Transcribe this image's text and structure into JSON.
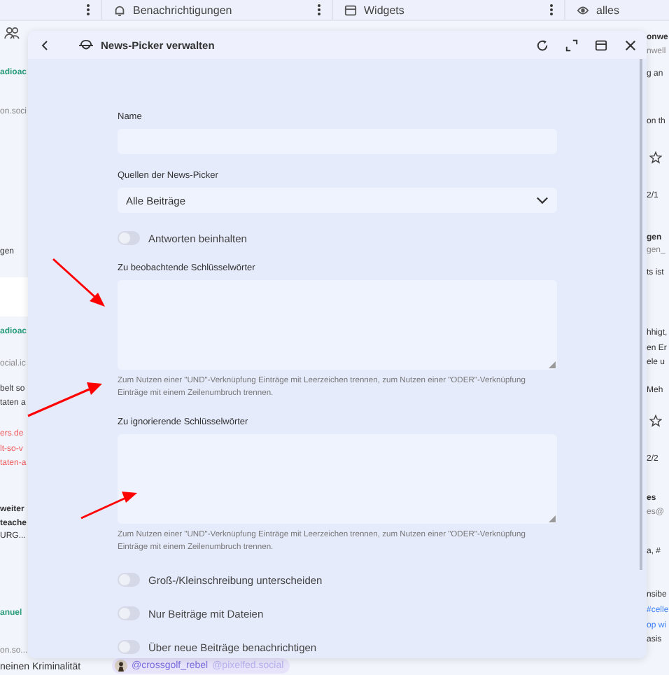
{
  "background": {
    "column_headers": [
      {
        "label": "Benachrichtigungen"
      },
      {
        "label": "Widgets"
      },
      {
        "label": "alles"
      }
    ],
    "left_fragments": [
      {
        "kind": "name",
        "text": "adioac"
      },
      {
        "kind": "handle",
        "text": "on.soci"
      },
      {
        "kind": "text",
        "text": "gen"
      },
      {
        "kind": "name",
        "text": "adioac"
      },
      {
        "kind": "handle",
        "text": "ocial.ic"
      },
      {
        "kind": "text",
        "text": "belt so"
      },
      {
        "kind": "text",
        "text": "taten a"
      },
      {
        "kind": "link",
        "text": "ers.de"
      },
      {
        "kind": "link",
        "text": "lt-so-v"
      },
      {
        "kind": "link",
        "text": "taten-a"
      },
      {
        "kind": "bold",
        "text": "weiter"
      },
      {
        "kind": "bold",
        "text": "teache"
      },
      {
        "kind": "text",
        "text": "URG..."
      },
      {
        "kind": "name",
        "text": "anuel"
      },
      {
        "kind": "handle",
        "text": "on.so..."
      }
    ],
    "right_fragments": [
      {
        "kind": "bold",
        "text": "onwe"
      },
      {
        "kind": "handle",
        "text": "nwell"
      },
      {
        "kind": "text",
        "text": "g an"
      },
      {
        "kind": "text",
        "text": "on th"
      },
      {
        "kind": "star"
      },
      {
        "kind": "text",
        "text": "2/1"
      },
      {
        "kind": "bold",
        "text": "gen"
      },
      {
        "kind": "handle",
        "text": "gen_"
      },
      {
        "kind": "text",
        "text": "ts ist"
      },
      {
        "kind": "text",
        "text": "hhigt,"
      },
      {
        "kind": "text",
        "text": "en Er"
      },
      {
        "kind": "text",
        "text": "ele u"
      },
      {
        "kind": "text",
        "text": "Meh"
      },
      {
        "kind": "star"
      },
      {
        "kind": "text",
        "text": "2/2"
      },
      {
        "kind": "bold",
        "text": "es"
      },
      {
        "kind": "handle",
        "text": "es@"
      },
      {
        "kind": "text",
        "text": "a, #"
      },
      {
        "kind": "text",
        "text": "nsibe"
      },
      {
        "kind": "tag",
        "text": "#celle"
      },
      {
        "kind": "tag",
        "text": "op wi"
      },
      {
        "kind": "text",
        "text": "asis"
      }
    ],
    "bottom_text": "neinen Kriminalität",
    "mention": {
      "name": "@crossgolf_rebel",
      "domain": "@pixelfed.social"
    }
  },
  "dialog": {
    "title": "News-Picker verwalten",
    "fields": [
      {
        "kind": "text",
        "label": "Name"
      },
      {
        "kind": "select",
        "label": "Quellen der News-Picker",
        "value": "Alle Beiträge"
      },
      {
        "kind": "toggle",
        "label": "Antworten beinhalten",
        "on": false
      },
      {
        "kind": "textarea",
        "label": "Zu beobachtende Schlüsselwörter",
        "hint": "Zum Nutzen einer \"UND\"-Verknüpfung Einträge mit Leerzeichen trennen, zum Nutzen einer \"ODER\"-Verknüpfung Einträge mit einem Zeilenumbruch trennen."
      },
      {
        "kind": "textarea",
        "label": "Zu ignorierende Schlüsselwörter",
        "hint": "Zum Nutzen einer \"UND\"-Verknüpfung Einträge mit Leerzeichen trennen, zum Nutzen einer \"ODER\"-Verknüpfung Einträge mit einem Zeilenumbruch trennen."
      },
      {
        "kind": "toggle",
        "label": "Groß-/Kleinschreibung unterscheiden",
        "on": false
      },
      {
        "kind": "toggle",
        "label": "Nur Beiträge mit Dateien",
        "on": false
      },
      {
        "kind": "toggle",
        "label": "Über neue Beiträge benachrichtigen",
        "on": false
      }
    ]
  }
}
